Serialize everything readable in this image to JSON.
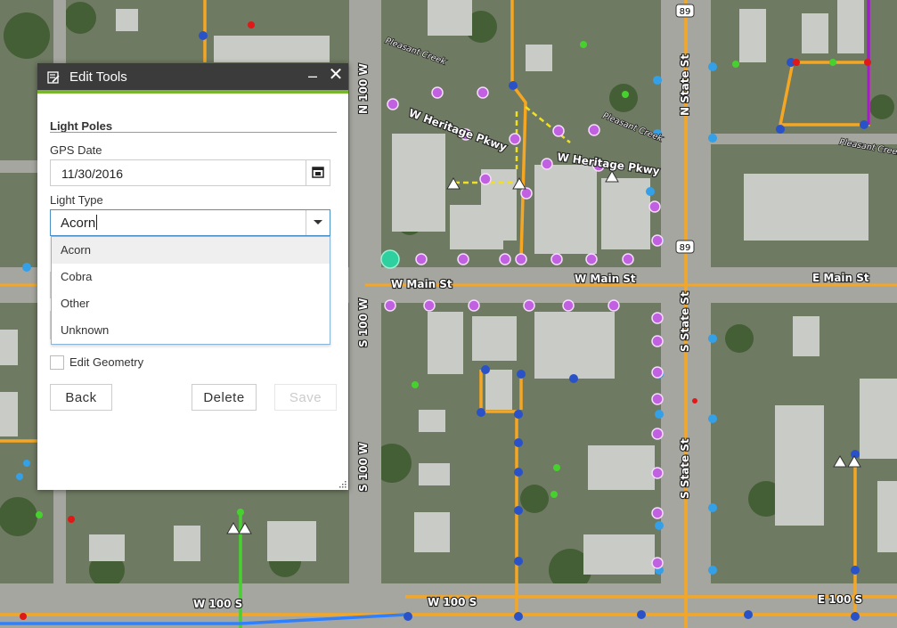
{
  "map": {
    "street_labels": [
      "N 100 W",
      "N State St",
      "W Heritage Pkwy",
      "W Heritage Pkwy",
      "W Main St",
      "W Main St",
      "E Main St",
      "S 100 W",
      "S 100 W",
      "S State St",
      "S State St",
      "W 100 S",
      "W 100 S",
      "E 100 S"
    ],
    "creek_labels": [
      "Pleasant Creek",
      "Pleasant Creek",
      "Pleasant Creek"
    ],
    "route_shields": [
      "89",
      "89"
    ],
    "colors": {
      "road": "#f5a623",
      "sewer": "#2a52c8",
      "water": "#2f80ff",
      "pole": "#b84bd8",
      "green": "#47d12f",
      "purple_line": "#a020c8"
    }
  },
  "panel": {
    "title": "Edit Tools",
    "minimize_symbol": "–",
    "close_symbol": "✕",
    "layer_title": "Light Poles",
    "fields": {
      "gps_date_label": "GPS Date",
      "gps_date_value": "11/30/2016",
      "light_type_label": "Light Type",
      "light_type_value": "Acorn"
    },
    "dropdown_options": [
      "Acorn",
      "Cobra",
      "Other",
      "Unknown"
    ],
    "edit_geometry_label": "Edit Geometry",
    "buttons": {
      "back": "Back",
      "delete": "Delete",
      "save": "Save"
    }
  }
}
